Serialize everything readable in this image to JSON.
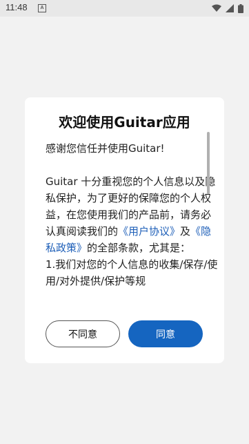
{
  "status_bar": {
    "time": "11:48",
    "notification_icon": "A",
    "icons": [
      "wifi-icon",
      "signal-icon",
      "battery-icon"
    ]
  },
  "dialog": {
    "title": "欢迎使用Guitar应用",
    "greeting": "感谢您信任并使用Guitar!",
    "para_prefix": " Guitar 十分重视您的个人信息以及隐私保护，为了更好的保障您的个人权益，在您使用我们的产品前，请务必认真阅读我们的",
    "user_agreement_link": "《用户协议》",
    "and_text": "及",
    "privacy_policy_link": "《隐私政策》",
    "para_suffix": "的全部条款，尤其是：",
    "item_1": "  1.我们对您的个人信息的收集/保存/使用/对外提供/保护等规",
    "disagree_label": "不同意",
    "agree_label": "同意"
  },
  "colors": {
    "accent": "#1565c0",
    "link": "#1e5fb8",
    "background": "#f2f2f2",
    "statusbar": "#e8e8e8"
  }
}
